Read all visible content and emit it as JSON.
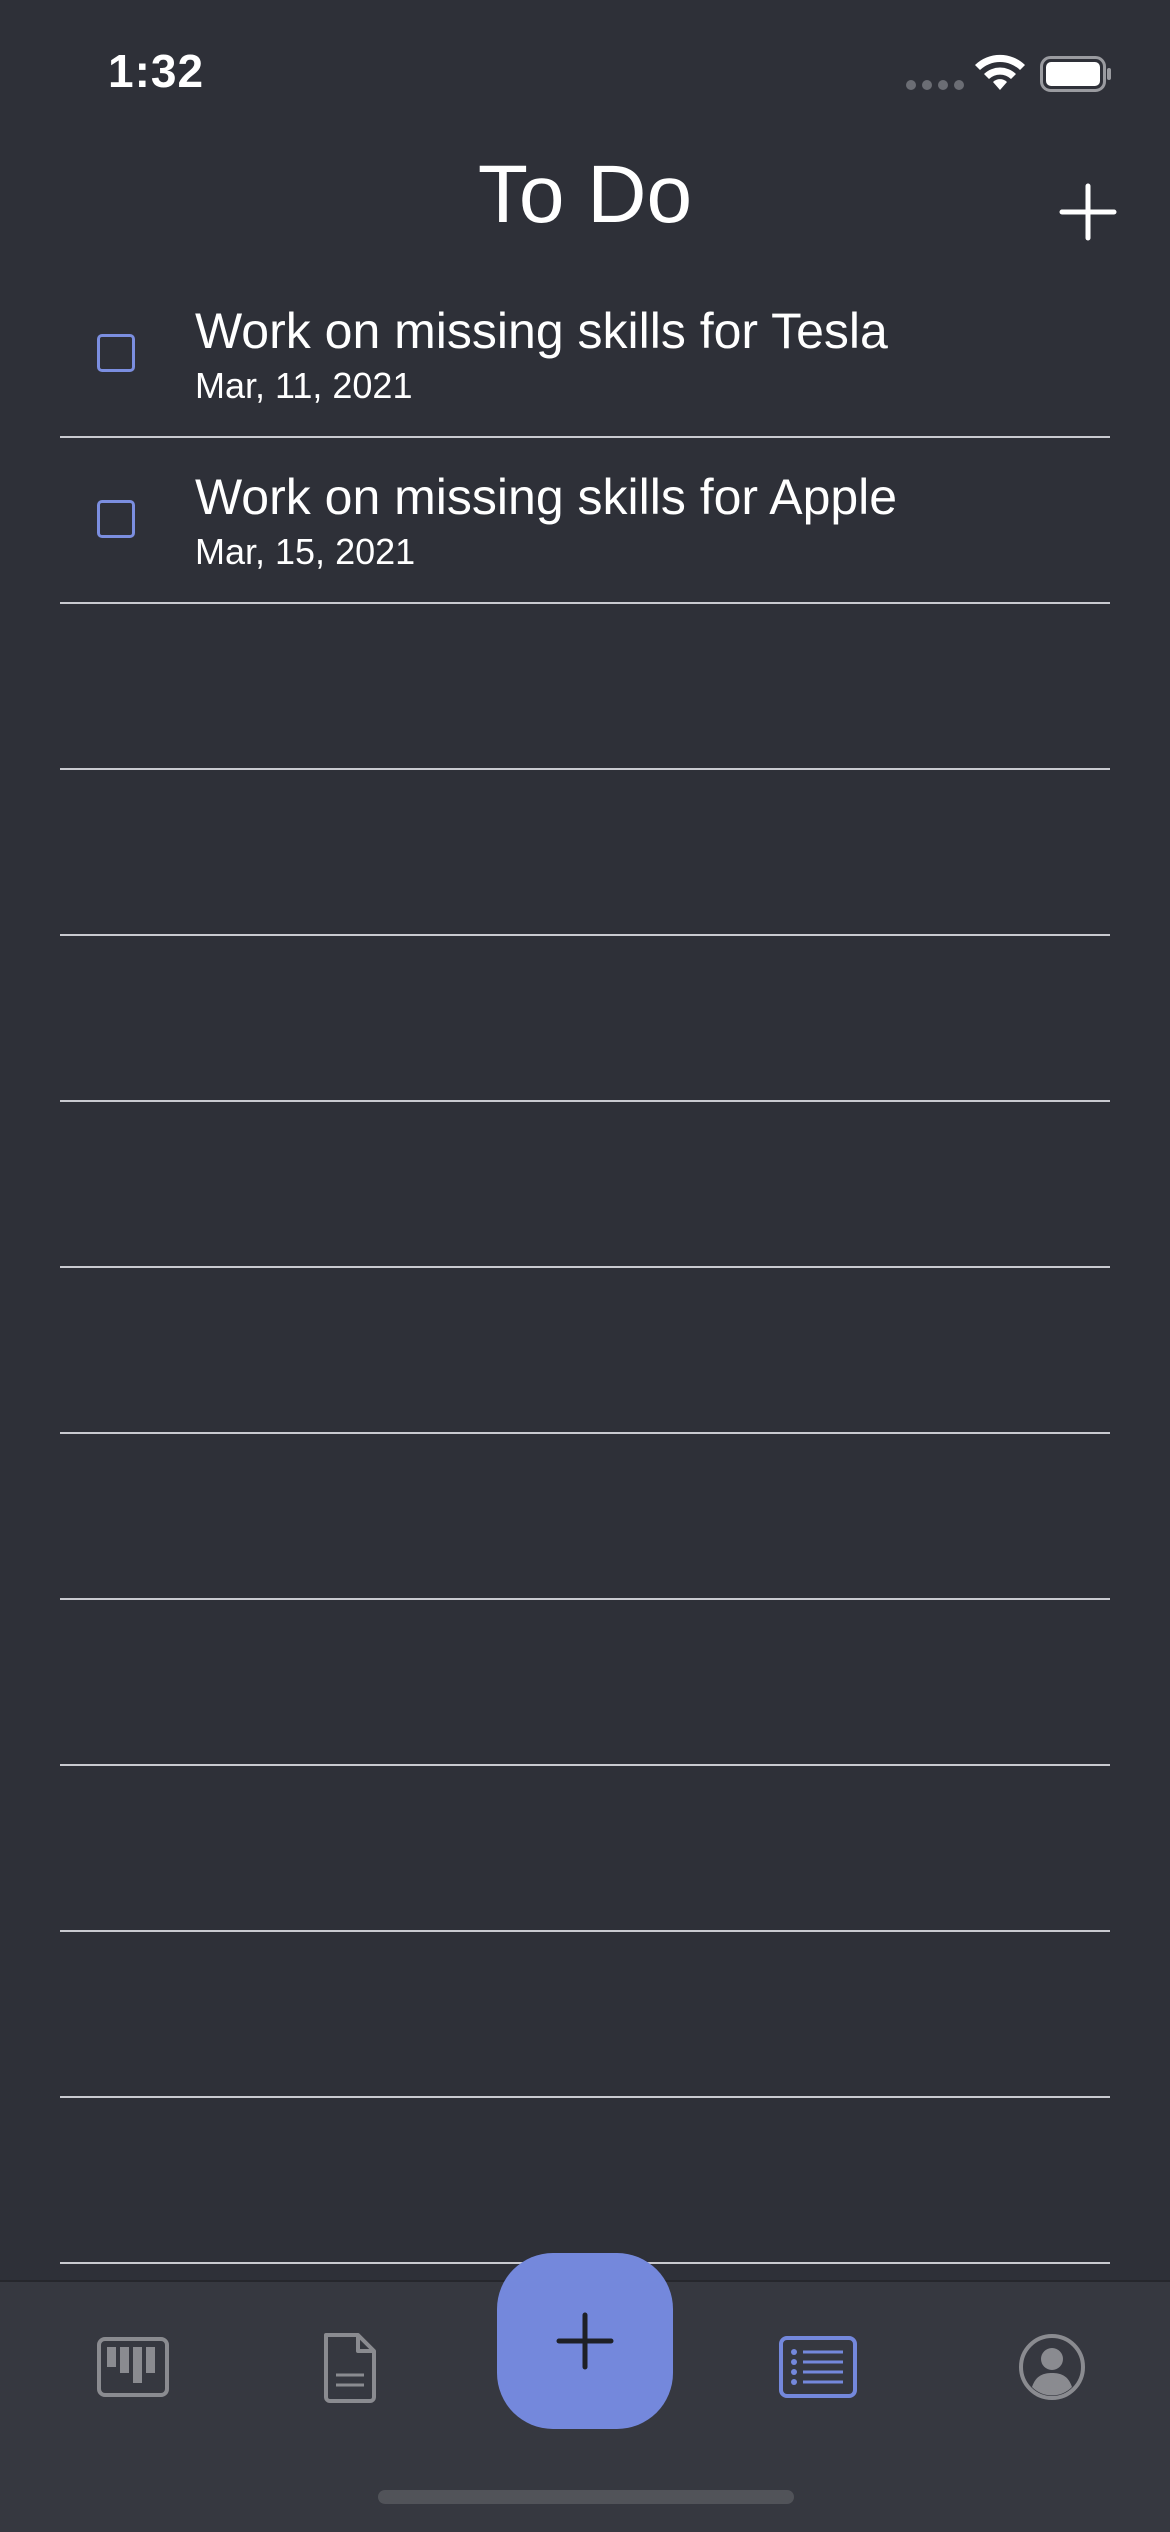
{
  "status_bar": {
    "time": "1:32"
  },
  "header": {
    "title": "To Do",
    "add_icon": "plus-icon"
  },
  "todos": [
    {
      "title": "Work on missing skills for Tesla",
      "date": "Mar, 11, 2021",
      "checked": false
    },
    {
      "title": "Work on missing skills for Apple",
      "date": "Mar, 15, 2021",
      "checked": false
    }
  ],
  "tab_bar": {
    "tabs": [
      {
        "icon": "board-icon",
        "active": false
      },
      {
        "icon": "document-icon",
        "active": false
      },
      {
        "icon": "plus-icon",
        "active": false
      },
      {
        "icon": "list-icon",
        "active": true
      },
      {
        "icon": "profile-icon",
        "active": false
      }
    ]
  },
  "colors": {
    "background": "#2e3038",
    "accent": "#7488dc",
    "divider": "#c9cad0",
    "inactive_icon": "#8a8b90"
  }
}
